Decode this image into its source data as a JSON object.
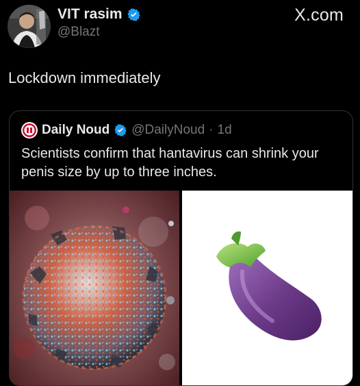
{
  "author": {
    "display_name": "VIT rasim",
    "handle": "@Blazt",
    "avatar_icon": "avatar-photo",
    "verified_icon": "verified-badge-icon"
  },
  "brand": "X.com",
  "tweet": {
    "text": "Lockdown immediately"
  },
  "quoted": {
    "display_name": "Daily Noud",
    "handle": "@DailyNoud",
    "separator": "·",
    "time": "1d",
    "text": "Scientists confirm that hantavirus can shrink your penis size by up to three inches.",
    "logo_icon": "daily-noud-logo",
    "media": [
      {
        "name": "virus-render-image"
      },
      {
        "name": "eggplant-emoji-image"
      }
    ]
  },
  "colors": {
    "background": "#000000",
    "text_primary": "#e7e9ea",
    "text_secondary": "#71767b",
    "verified": "#1d9bf0",
    "border": "#2f3336"
  }
}
